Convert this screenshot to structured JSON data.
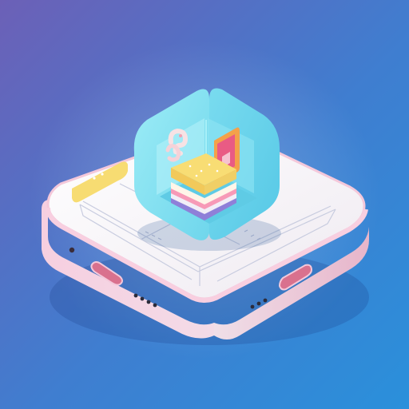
{
  "scene": {
    "background_top": "#6a63b8",
    "background_bottom": "#2f8bd6",
    "base_color": "#f7f3f6",
    "base_rim_color": "#f2b9cf",
    "room_color": "#7ee2f1",
    "accent_yellow": "#f8df77",
    "accent_pink": "#f27aa1",
    "icons": [
      "isometric-base-icon",
      "room-cube-icon",
      "stacked-books-icon",
      "picture-frame-icon",
      "hook-icon"
    ]
  }
}
